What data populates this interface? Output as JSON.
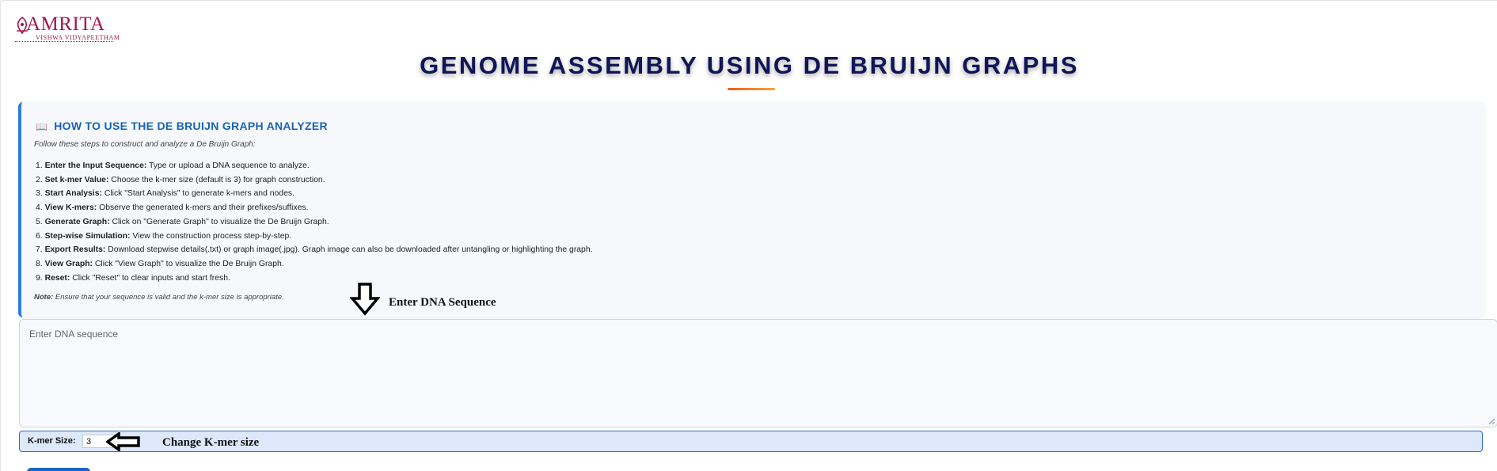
{
  "logo": {
    "wordmark": "AMRITA",
    "subtitle": "VISHWA VIDYAPEETHAM"
  },
  "page_title": "GENOME ASSEMBLY USING DE BRUIJN GRAPHS",
  "help": {
    "icon": "book-icon",
    "heading": "HOW TO USE THE DE BRUIJN GRAPH ANALYZER",
    "intro": "Follow these steps to construct and analyze a De Bruijn Graph:",
    "steps": [
      {
        "num": "1.",
        "title": "Enter the Input Sequence:",
        "text": " Type or upload a DNA sequence to analyze."
      },
      {
        "num": "2.",
        "title": "Set k-mer Value:",
        "text": " Choose the k-mer size (default is 3) for graph construction."
      },
      {
        "num": "3.",
        "title": "Start Analysis:",
        "text": " Click \"Start Analysis\" to generate k-mers and nodes."
      },
      {
        "num": "4.",
        "title": "View K-mers:",
        "text": " Observe the generated k-mers and their prefixes/suffixes."
      },
      {
        "num": "5.",
        "title": "Generate Graph:",
        "text": " Click on \"Generate Graph\" to visualize the De Bruijn Graph."
      },
      {
        "num": "6.",
        "title": "Step-wise Simulation:",
        "text": " View the construction process step-by-step."
      },
      {
        "num": "7.",
        "title": "Export Results:",
        "text": " Download stepwise details(.txt) or graph image(.jpg). Graph image can also be downloaded after untangling or highlighting the graph."
      },
      {
        "num": "8.",
        "title": "View Graph:",
        "text": " Click \"View Graph\" to visualize the De Bruijn Graph."
      },
      {
        "num": "9.",
        "title": "Reset:",
        "text": " Click \"Reset\" to clear inputs and start fresh."
      }
    ],
    "note_label": "Note:",
    "note_text": " Ensure that your sequence is valid and the k-mer size is appropriate."
  },
  "annotations": {
    "dna": "Enter DNA Sequence",
    "kmer": "Change K-mer size"
  },
  "dna_input": {
    "placeholder": "Enter DNA sequence",
    "value": ""
  },
  "kmer": {
    "label": "K-mer Size:",
    "value": "3"
  },
  "colors": {
    "title": "#0f1557",
    "accent_blue": "#2f7ed8",
    "heading_blue": "#1763b4",
    "brand": "#a3154a",
    "underline_start": "#f15a24",
    "underline_end": "#f7a531"
  }
}
